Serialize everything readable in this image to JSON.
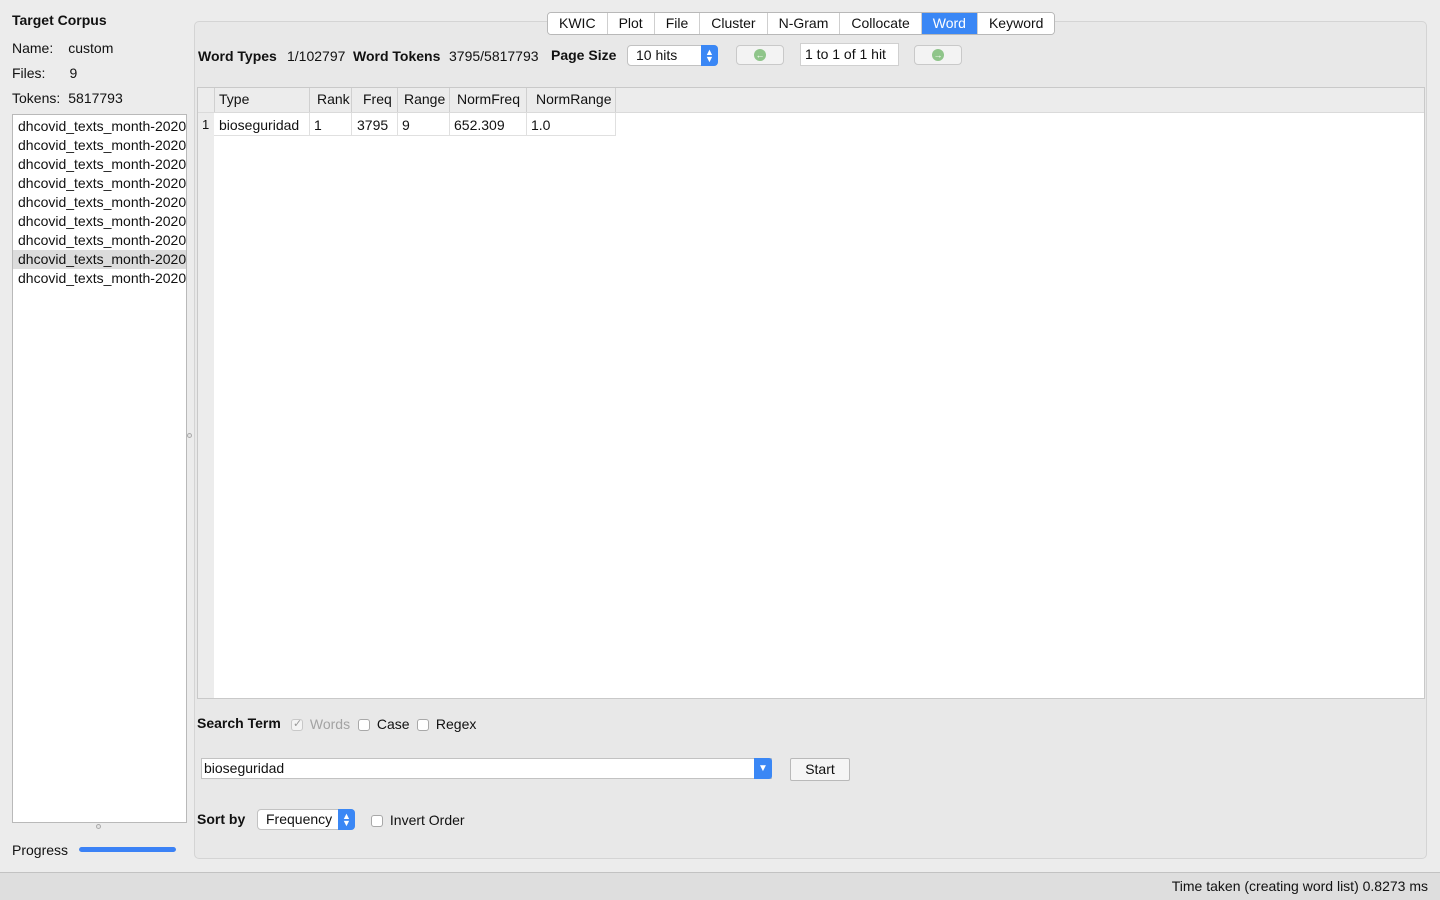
{
  "sidebar": {
    "title": "Target Corpus",
    "name_label": "Name:",
    "name_value": "custom",
    "files_label": "Files:",
    "files_value": "9",
    "tokens_label": "Tokens:",
    "tokens_value": "5817793",
    "files": [
      "dhcovid_texts_month-2020",
      "dhcovid_texts_month-2020",
      "dhcovid_texts_month-2020",
      "dhcovid_texts_month-2020",
      "dhcovid_texts_month-2020",
      "dhcovid_texts_month-2020",
      "dhcovid_texts_month-2020",
      "dhcovid_texts_month-2020",
      "dhcovid_texts_month-2020"
    ],
    "selected_file_index": 7,
    "progress_label": "Progress",
    "progress_fraction": 1.0
  },
  "tabs": [
    "KWIC",
    "Plot",
    "File",
    "Cluster",
    "N-Gram",
    "Collocate",
    "Word",
    "Keyword"
  ],
  "active_tab": "Word",
  "stats": {
    "word_types_label": "Word Types",
    "word_types_value": "1/102797",
    "word_tokens_label": "Word Tokens",
    "word_tokens_value": "3795/5817793",
    "page_size_label": "Page Size",
    "page_size_value": "10 hits",
    "page_info": "1 to 1 of 1 hit",
    "prev_icon": "arrow-left-circle-icon",
    "next_icon": "arrow-right-circle-icon"
  },
  "table": {
    "columns": [
      "Type",
      "Rank",
      "Freq",
      "Range",
      "NormFreq",
      "NormRange"
    ],
    "rows": [
      {
        "num": "1",
        "cells": [
          "bioseguridad",
          "1",
          "3795",
          "9",
          "652.309",
          "1.0"
        ]
      }
    ]
  },
  "search": {
    "label": "Search Term",
    "words_label": "Words",
    "words_checked": true,
    "case_label": "Case",
    "case_checked": false,
    "regex_label": "Regex",
    "regex_checked": false,
    "value": "bioseguridad",
    "start_label": "Start"
  },
  "sort": {
    "label": "Sort by",
    "value": "Frequency",
    "invert_label": "Invert Order",
    "invert_checked": false
  },
  "status": {
    "text": "Time taken (creating word list) 0.8273 ms"
  },
  "colors": {
    "accent": "#3a87f5",
    "progress": "#3b82f6"
  }
}
